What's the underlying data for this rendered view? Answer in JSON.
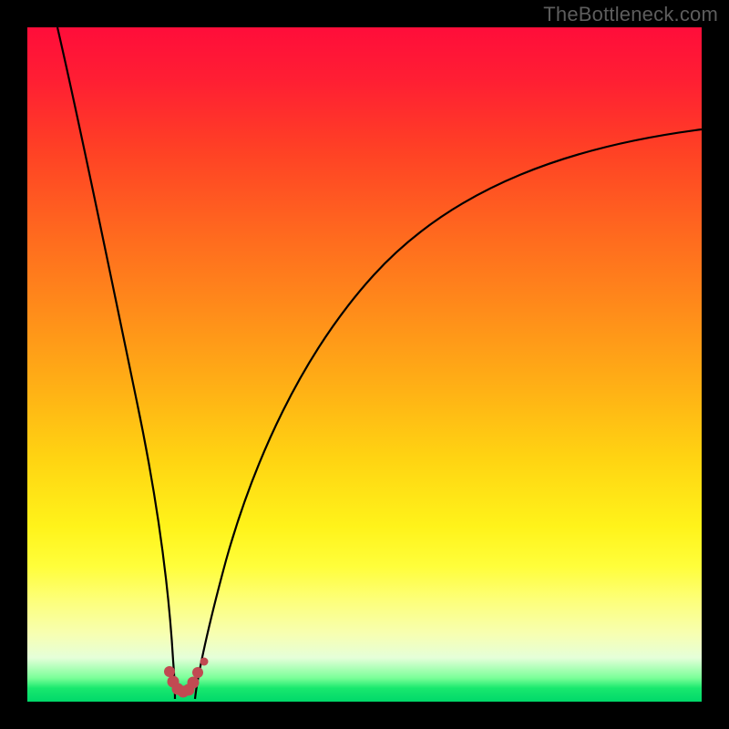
{
  "watermark": {
    "text": "TheBottleneck.com"
  },
  "chart_data": {
    "type": "line",
    "title": "",
    "xlabel": "",
    "ylabel": "",
    "xlim": [
      0,
      100
    ],
    "ylim": [
      0,
      100
    ],
    "grid": false,
    "legend": false,
    "background_gradient": {
      "stops": [
        {
          "pos": 0,
          "color": "#ff0d3a"
        },
        {
          "pos": 0.5,
          "color": "#ffa018"
        },
        {
          "pos": 0.8,
          "color": "#fffe3b"
        },
        {
          "pos": 1.0,
          "color": "#00d86a"
        }
      ]
    },
    "series": [
      {
        "name": "left-branch",
        "color": "#000000",
        "x": [
          4.5,
          6,
          8,
          10,
          12,
          14,
          16,
          18,
          19.5,
          20.5,
          21.3,
          21.8
        ],
        "y": [
          100,
          90,
          77,
          64,
          52,
          40,
          29,
          18,
          10,
          5,
          2,
          0.5
        ]
      },
      {
        "name": "right-branch",
        "color": "#000000",
        "x": [
          24.8,
          25.5,
          27,
          29,
          32,
          36,
          41,
          47,
          54,
          62,
          71,
          81,
          91,
          100
        ],
        "y": [
          0.5,
          5,
          14,
          24,
          35,
          46,
          55,
          62.5,
          68.5,
          73.5,
          77.5,
          80.6,
          83,
          84.8
        ]
      },
      {
        "name": "valley-marker",
        "color": "#c14a52",
        "x": [
          21.0,
          21.8,
          22.4,
          23.0,
          23.8,
          24.5,
          25.2,
          26.2
        ],
        "y": [
          4.5,
          2.5,
          1.5,
          1.3,
          1.5,
          2.5,
          4.2,
          6.0
        ]
      }
    ]
  }
}
